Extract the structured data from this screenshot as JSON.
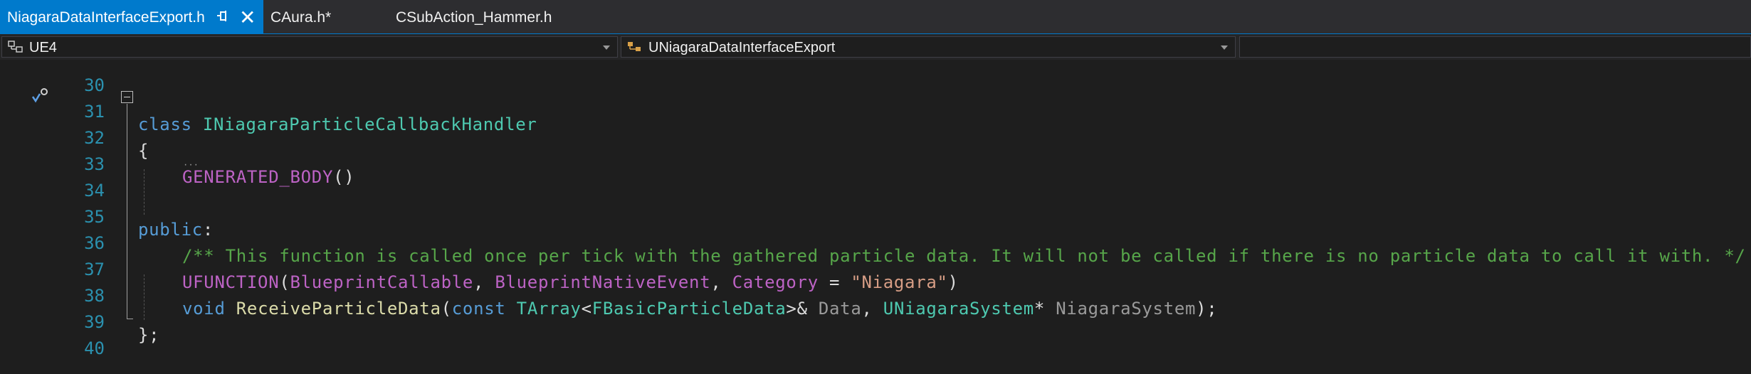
{
  "tabs": [
    {
      "label": "NiagaraDataInterfaceExport.h",
      "active": true
    },
    {
      "label": "CAura.h*"
    },
    {
      "label": "CSubAction_Hammer.h"
    }
  ],
  "tab_icons": {
    "pin": "pin-icon",
    "close": "✕"
  },
  "navbar": {
    "project": "UE4",
    "scope": "UNiagaraDataInterfaceExport",
    "member": ""
  },
  "colors": {
    "accent": "#007acc",
    "keyword": "#569cd6",
    "type": "#4ec9b0",
    "macro": "#bd63c5",
    "comment": "#57a64a",
    "string": "#d69d85",
    "function": "#dcdcaa",
    "line_number": "#2b91af"
  },
  "lines": [
    {
      "num": "30",
      "text": ""
    },
    {
      "num": "31",
      "p": [
        "class",
        " ",
        "INiagaraParticleCallbackHandler"
      ]
    },
    {
      "num": "32",
      "text": "{"
    },
    {
      "num": "33",
      "p": [
        "GENERATED_BODY",
        "()"
      ]
    },
    {
      "num": "34",
      "text": ""
    },
    {
      "num": "35",
      "p": [
        "public",
        ":"
      ]
    },
    {
      "num": "36",
      "text": "/** This function is called once per tick with the gathered particle data. It will not be called if there is no particle data to call it with. */"
    },
    {
      "num": "37",
      "p": [
        "UFUNCTION",
        "(",
        "BlueprintCallable",
        ", ",
        "BlueprintNativeEvent",
        ", ",
        "Category",
        " = ",
        "\"Niagara\"",
        ")"
      ]
    },
    {
      "num": "38",
      "p": [
        "void",
        " ",
        "ReceiveParticleData",
        "(",
        "const",
        " ",
        "TArray",
        "<",
        "FBasicParticleData",
        ">& ",
        "Data",
        ", ",
        "UNiagaraSystem",
        "* ",
        "NiagaraSystem",
        ");"
      ]
    },
    {
      "num": "39",
      "text": "};"
    },
    {
      "num": "40",
      "text": ""
    }
  ]
}
